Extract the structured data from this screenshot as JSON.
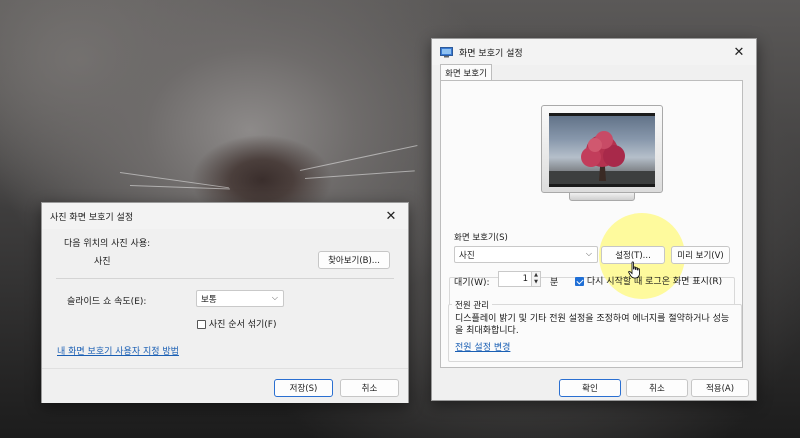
{
  "photo_dialog": {
    "title": "사진 화면 보호기 설정",
    "close_glyph": "✕",
    "location_label": "다음 위치의 사진 사용:",
    "folder_name": "사진",
    "browse_label": "찾아보기(B)...",
    "speed_label": "슬라이드 쇼 속도(E):",
    "speed_value": "보통",
    "shuffle_label": "사진 순서 섞기(F)",
    "shuffle_checked": false,
    "customize_link": "내 화면 보호기 사용자 지정 방법",
    "save_label": "저장(S)",
    "cancel_label": "취소"
  },
  "screensaver_dialog": {
    "title": "화면 보호기 설정",
    "close_glyph": "✕",
    "tab_label": "화면 보호기",
    "screensaver_group_label": "화면 보호기(S)",
    "screensaver_value": "사진",
    "settings_label": "설정(T)...",
    "preview_label": "미리 보기(V)",
    "wait_label": "대기(W):",
    "wait_value": "1",
    "wait_unit": "분",
    "resume_label": "다시 시작할 때 로그온 화면 표시(R)",
    "resume_checked": true,
    "power_group_label": "전원 관리",
    "power_description": "디스플레이 밝기 및 기타 전원 설정을 조정하여 에너지를 절약하거나 성능을 최대화합니다.",
    "power_link": "전원 설정 변경",
    "ok_label": "확인",
    "cancel_label": "취소",
    "apply_label": "적용(A)"
  },
  "colors": {
    "accent": "#2a6fd1",
    "link": "#1a5fb4",
    "highlight": "#fff878"
  }
}
